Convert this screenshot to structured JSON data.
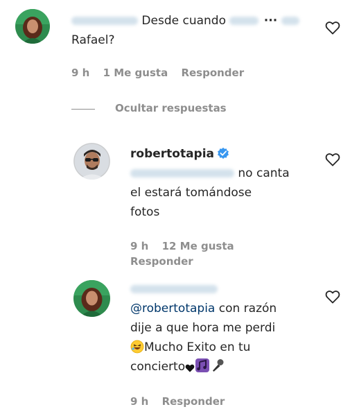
{
  "comments": [
    {
      "text_line1": "Desde cuando",
      "text_line2": "Rafael?",
      "time": "9 h",
      "likes": "1 Me gusta",
      "reply": "Responder"
    }
  ],
  "replies_toggle": "Ocultar respuestas",
  "replies": [
    {
      "username": "robertotapia",
      "verified": true,
      "text_line1": "no canta",
      "text_line2": "el estará tomándose",
      "text_line3": "fotos",
      "time": "9 h",
      "likes": "12 Me gusta",
      "reply": "Responder"
    },
    {
      "mention": "@robertotapia",
      "text_line1": "con razón",
      "text_line2": "dije a que hora me perdi",
      "text_line3": "Mucho Exito en tu",
      "text_line4": "concierto",
      "time": "9 h",
      "reply": "Responder"
    }
  ],
  "icons": {
    "like": "heart-outline-icon",
    "verified": "verified-badge-icon",
    "emoji_laugh": "rolling-laughing-emoji",
    "emoji_heart": "black-heart-emoji",
    "emoji_music": "musical-notes-emoji",
    "emoji_mic": "microphone-emoji"
  },
  "colors": {
    "text": "#262626",
    "secondary": "#8e8e8e",
    "mention": "#00376b",
    "verified": "#3897f0"
  }
}
